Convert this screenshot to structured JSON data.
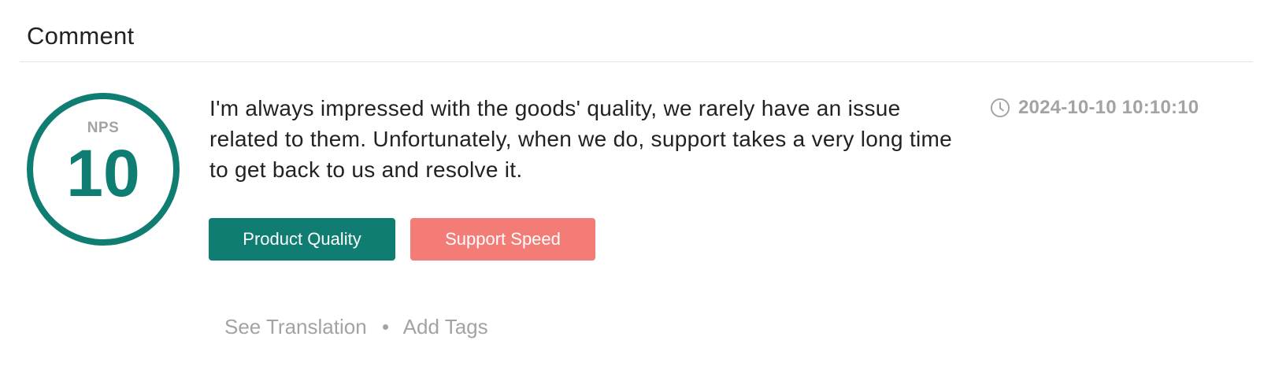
{
  "header": {
    "title": "Comment"
  },
  "nps": {
    "label": "NPS",
    "score": "10",
    "color": "#0f7d71"
  },
  "comment": {
    "text": "I'm always impressed with the goods' quality, we rarely have an issue related to them. Unfortunately, when we do, support takes a very long time to get back to us and resolve it.",
    "timestamp": "2024-10-10 10:10:10",
    "timestamp_icon": "clock-icon"
  },
  "tags": [
    {
      "label": "Product Quality",
      "color": "#0f7d71"
    },
    {
      "label": "Support Speed",
      "color": "#f47c76"
    }
  ],
  "actions": {
    "see_translation": "See Translation",
    "add_tags": "Add Tags"
  }
}
